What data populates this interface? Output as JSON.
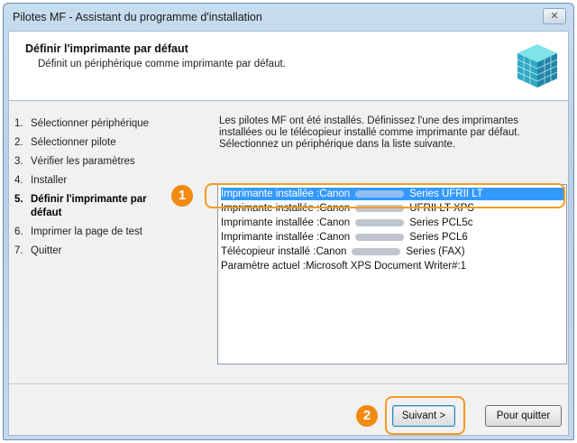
{
  "window": {
    "title": "Pilotes MF - Assistant du programme d'installation",
    "close_label": "✕"
  },
  "header": {
    "title": "Définir l'imprimante par défaut",
    "subtitle": "Définit un périphérique comme imprimante par défaut."
  },
  "steps": [
    {
      "num": "1.",
      "label": "Sélectionner périphérique"
    },
    {
      "num": "2.",
      "label": "Sélectionner pilote"
    },
    {
      "num": "3.",
      "label": "Vérifier les paramètres"
    },
    {
      "num": "4.",
      "label": "Installer"
    },
    {
      "num": "5.",
      "label": "Définir l'imprimante par défaut",
      "active": true
    },
    {
      "num": "6.",
      "label": "Imprimer la page de test"
    },
    {
      "num": "7.",
      "label": "Quitter"
    }
  ],
  "info": {
    "text": "Les pilotes MF ont été installés. Définissez l'une des imprimantes installées ou le télécopieur installé comme imprimante par défaut.",
    "prompt": "Sélectionnez un périphérique dans la liste suivante."
  },
  "list": {
    "items": [
      {
        "prefix": "Imprimante installée :Canon",
        "suffix": "Series UFRII LT",
        "selected": true
      },
      {
        "prefix": "Imprimante installée :Canon",
        "suffix": "UFRII LT XPS"
      },
      {
        "prefix": "Imprimante installée :Canon",
        "suffix": "Series PCL5c"
      },
      {
        "prefix": "Imprimante installée :Canon",
        "suffix": "Series PCL6"
      },
      {
        "prefix": "Télécopieur installé :Canon",
        "suffix": "Series (FAX)"
      },
      {
        "prefix": "Paramètre actuel :Microsoft XPS Document Writer#:1",
        "suffix": ""
      }
    ]
  },
  "callouts": {
    "one": "1",
    "two": "2"
  },
  "buttons": {
    "next": "Suivant >",
    "quit": "Pour quitter"
  },
  "colors": {
    "selection": "#3399ff",
    "callout": "#f08a12"
  }
}
